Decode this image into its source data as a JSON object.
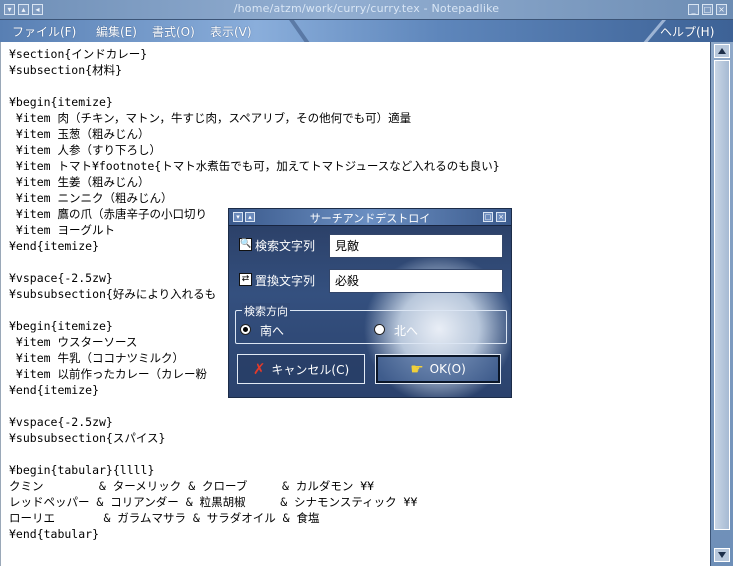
{
  "window": {
    "title": "/home/atzm/work/curry/curry.tex - Notepadlike",
    "accent": "#6f8fb7"
  },
  "menu": {
    "items": [
      "ファイル(F)",
      "編集(E)",
      "書式(O)",
      "表示(V)"
    ],
    "help": "ヘルプ(H)"
  },
  "editor": {
    "lines": [
      "¥section{インドカレー}",
      "¥subsection{材料}",
      "",
      "¥begin{itemize}",
      " ¥item 肉（チキン，マトン，牛すじ肉，スペアリブ，その他何でも可）適量",
      " ¥item 玉葱（粗みじん）",
      " ¥item 人参（すり下ろし）",
      " ¥item トマト¥footnote{トマト水煮缶でも可，加えてトマトジュースなど入れるのも良い}",
      " ¥item 生姜（粗みじん）",
      " ¥item ニンニク（粗みじん）",
      " ¥item 鷹の爪（赤唐辛子の小口切り",
      " ¥item ヨーグルト",
      "¥end{itemize}",
      "",
      "¥vspace{-2.5zw}",
      "¥subsubsection{好みにより入れるも",
      "",
      "¥begin{itemize}",
      " ¥item ウスターソース",
      " ¥item 牛乳（ココナツミルク）",
      " ¥item 以前作ったカレー（カレー粉",
      "¥end{itemize}",
      "",
      "¥vspace{-2.5zw}",
      "¥subsubsection{スパイス}",
      "",
      "¥begin{tabular}{llll}",
      "クミン        & ターメリック & クローブ     & カルダモン ¥¥",
      "レッドペッパー & コリアンダー & 粒黒胡椒     & シナモンスティック ¥¥",
      "ローリエ       & ガラムマサラ & サラダオイル & 食塩",
      "¥end{tabular}"
    ]
  },
  "dialog": {
    "title": "サーチアンドデストロイ",
    "search_label": "検索文字列",
    "search_value": "見敵",
    "replace_label": "置換文字列",
    "replace_value": "必殺",
    "direction_legend": "検索方向",
    "south_label": "南へ",
    "north_label": "北へ",
    "cancel_label": "キャンセル(C)",
    "ok_label": "OK(O)",
    "selected_direction": "南へ"
  }
}
